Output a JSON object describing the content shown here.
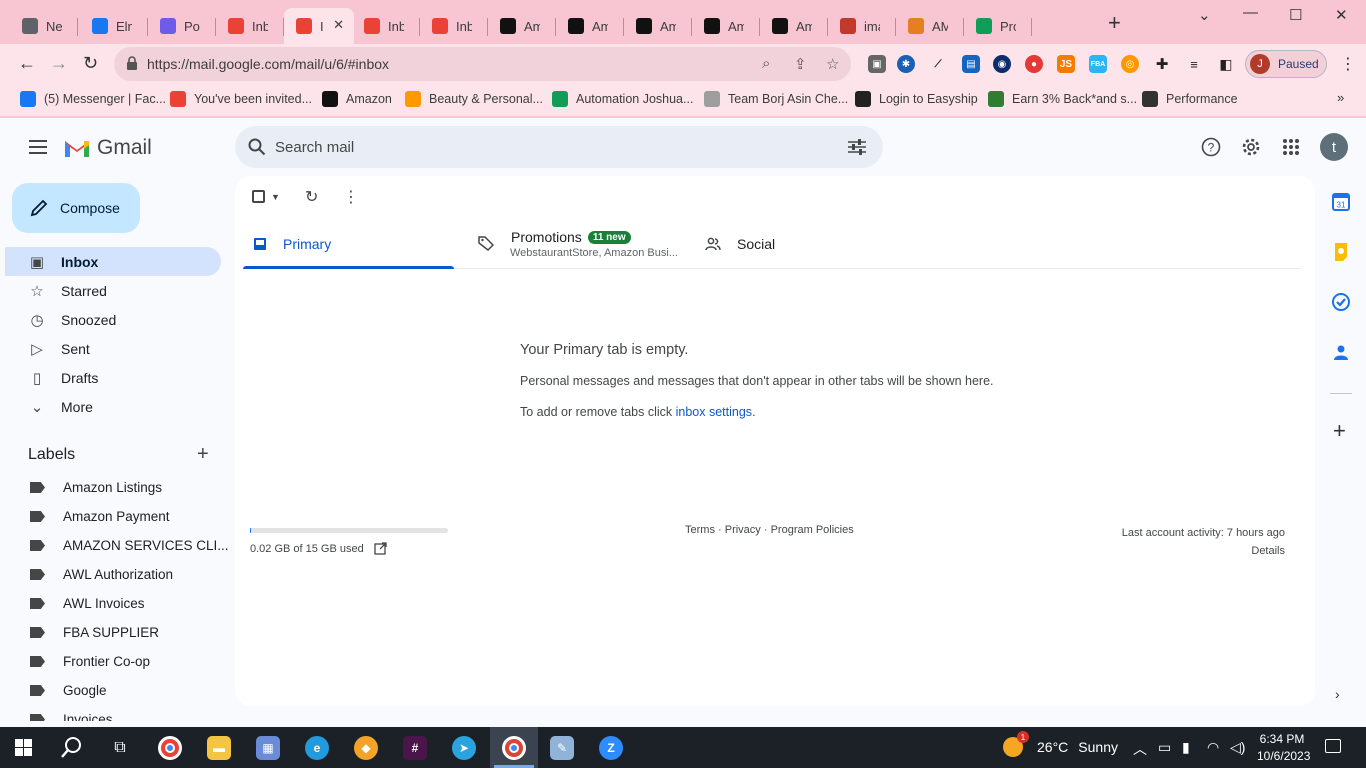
{
  "browser": {
    "tabs": [
      {
        "title": "New",
        "icon": "chrome-icon",
        "color": "#5f6368"
      },
      {
        "title": "Elme",
        "icon": "facebook-icon",
        "color": "#1877f2"
      },
      {
        "title": "Post",
        "icon": "postmark-icon",
        "color": "#6c5ce7"
      },
      {
        "title": "Inbo",
        "icon": "gmail-icon",
        "color": "#ea4335"
      },
      {
        "title": "I",
        "icon": "gmail-icon",
        "color": "#ea4335"
      },
      {
        "title": "Inbo",
        "icon": "gmail-icon",
        "color": "#ea4335"
      },
      {
        "title": "Inbo",
        "icon": "gmail-icon",
        "color": "#ea4335"
      },
      {
        "title": "Ama",
        "icon": "amazon-icon",
        "color": "#111111"
      },
      {
        "title": "Ama",
        "icon": "amazon-icon",
        "color": "#111111"
      },
      {
        "title": "Ama",
        "icon": "amazon-icon",
        "color": "#111111"
      },
      {
        "title": "Ama",
        "icon": "amazon-icon",
        "color": "#111111"
      },
      {
        "title": "Ama",
        "icon": "amazon-icon",
        "color": "#111111"
      },
      {
        "title": "imag",
        "icon": "image-icon",
        "color": "#c0392b"
      },
      {
        "title": "AMZ",
        "icon": "amz-icon",
        "color": "#e67e22"
      },
      {
        "title": "Profi",
        "icon": "sheets-icon",
        "color": "#0f9d58"
      }
    ],
    "active_tab_index": 4,
    "url": "https://mail.google.com/mail/u/6/#inbox",
    "profile_initial": "J",
    "profile_status": "Paused",
    "bookmarks": [
      {
        "label": "(5) Messenger | Fac...",
        "icon": "facebook-icon",
        "color": "#1877f2"
      },
      {
        "label": "You've been invited...",
        "icon": "gmail-icon",
        "color": "#ea4335"
      },
      {
        "label": "Amazon",
        "icon": "amazon-icon",
        "color": "#111111"
      },
      {
        "label": "Beauty & Personal...",
        "icon": "amazon-a-icon",
        "color": "#ff9900"
      },
      {
        "label": "Automation Joshua...",
        "icon": "sheets-icon",
        "color": "#0f9d58"
      },
      {
        "label": "Team Borj Asin Che...",
        "icon": "team-icon",
        "color": "#9e9e9e"
      },
      {
        "label": "Login to Easyship",
        "icon": "easyship-icon",
        "color": "#222222"
      },
      {
        "label": "Earn 3% Back*and s...",
        "icon": "earn-icon",
        "color": "#2e7d32"
      },
      {
        "label": "Performance",
        "icon": "globe-icon",
        "color": "#333333"
      }
    ]
  },
  "gmail": {
    "logo_text": "Gmail",
    "search_placeholder": "Search mail",
    "user_initial": "t",
    "compose_label": "Compose",
    "nav": [
      {
        "label": "Inbox",
        "icon": "inbox-icon",
        "active": true
      },
      {
        "label": "Starred",
        "icon": "star-icon"
      },
      {
        "label": "Snoozed",
        "icon": "clock-icon"
      },
      {
        "label": "Sent",
        "icon": "send-icon"
      },
      {
        "label": "Drafts",
        "icon": "draft-icon"
      },
      {
        "label": "More",
        "icon": "chevron-down-icon"
      }
    ],
    "labels_heading": "Labels",
    "labels": [
      "Amazon Listings",
      "Amazon Payment",
      "AMAZON SERVICES CLI...",
      "AWL Authorization",
      "AWL Invoices",
      "FBA SUPPLIER",
      "Frontier Co-op",
      "Google",
      "Invoices"
    ],
    "tabs": {
      "primary": "Primary",
      "promotions": "Promotions",
      "promotions_badge": "11 new",
      "promotions_sub": "WebstaurantStore, Amazon Busi...",
      "social": "Social"
    },
    "empty": {
      "title": "Your Primary tab is empty.",
      "desc": "Personal messages and messages that don't appear in other tabs will be shown here.",
      "tabs_prefix": "To add or remove tabs click ",
      "tabs_link": "inbox settings",
      "tabs_suffix": "."
    },
    "footer": {
      "storage": "0.02 GB of 15 GB used",
      "storage_fraction": 0.0013,
      "terms": "Terms",
      "privacy": "Privacy",
      "policies": "Program Policies",
      "activity": "Last account activity: 7 hours ago",
      "details": "Details"
    }
  },
  "taskbar": {
    "temperature": "26°C",
    "weather": "Sunny",
    "weather_badge": "1",
    "time": "6:34 PM",
    "date": "10/6/2023"
  }
}
